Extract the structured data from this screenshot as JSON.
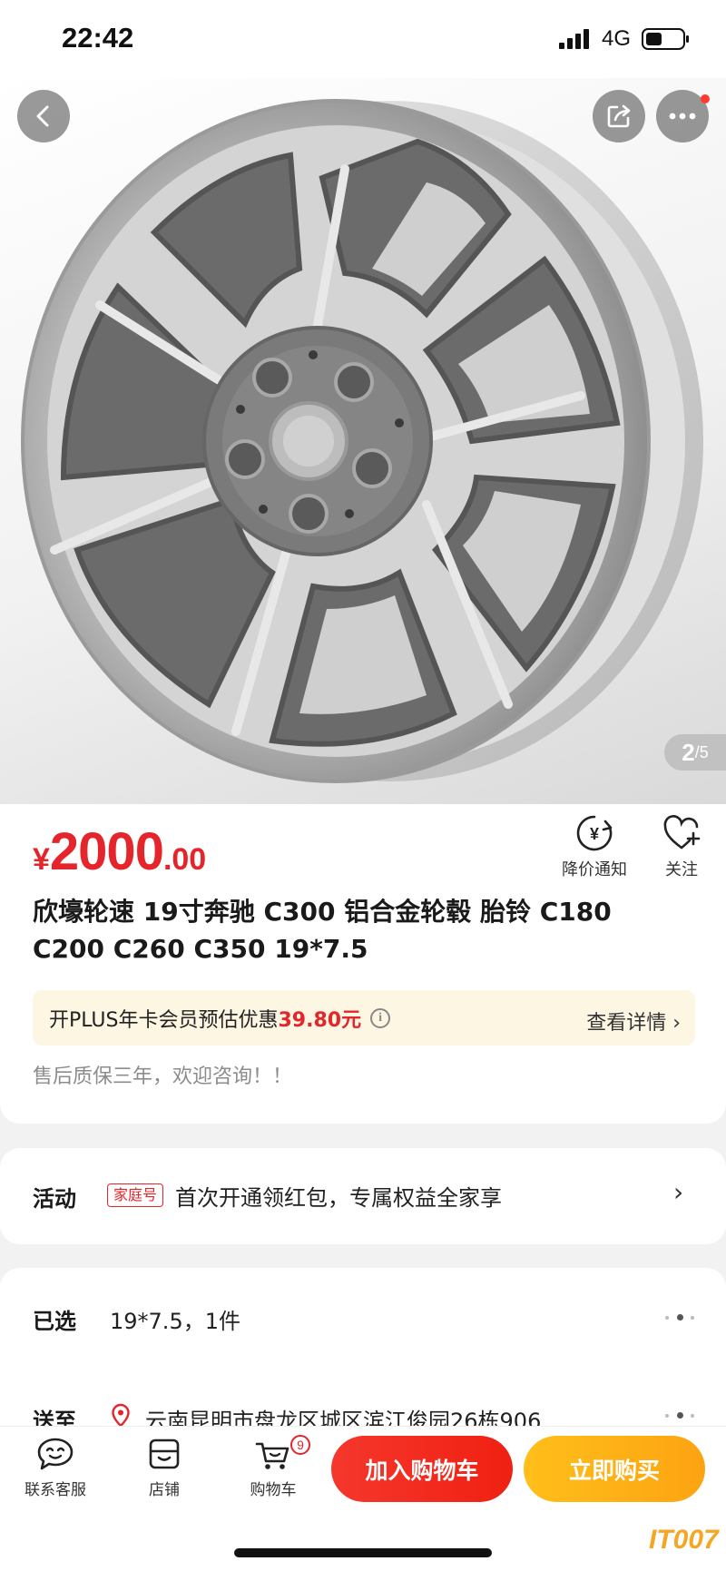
{
  "status_bar": {
    "time": "22:42",
    "network": "4G"
  },
  "gallery": {
    "current": "2",
    "total": "/5"
  },
  "price": {
    "currency": "¥",
    "integer": "2000",
    "decimal": ".00"
  },
  "actions": {
    "price_alert": "降价通知",
    "follow": "关注"
  },
  "product": {
    "title": "欣壕轮速 19寸奔驰 C300 铝合金轮毂 胎铃 C180 C200 C260 C350 19*7.5"
  },
  "plus": {
    "text": "开PLUS年卡会员预估优惠",
    "amount": "39.80元",
    "detail": "查看详情 ›"
  },
  "after_sale": "售后质保三年，欢迎咨询！！",
  "activity": {
    "label": "活动",
    "badge": "家庭号",
    "text": "首次开通领红包，专属权益全家享",
    "chevron": "›"
  },
  "selection": {
    "label": "已选",
    "value": "19*7.5，1件"
  },
  "shipping": {
    "label": "送至",
    "address": "云南昆明市盘龙区城区滨江俊园26栋906"
  },
  "bottom_bar": {
    "service": "联系客服",
    "store": "店铺",
    "cart": "购物车",
    "cart_count": "9",
    "add_to_cart": "加入购物车",
    "buy_now": "立即购买"
  },
  "watermark": "IT007",
  "colors": {
    "price_red": "#e4262c",
    "cart_button": "#f5372c",
    "buy_button": "#ffb31a",
    "plus_bg": "#fdf6e3"
  }
}
